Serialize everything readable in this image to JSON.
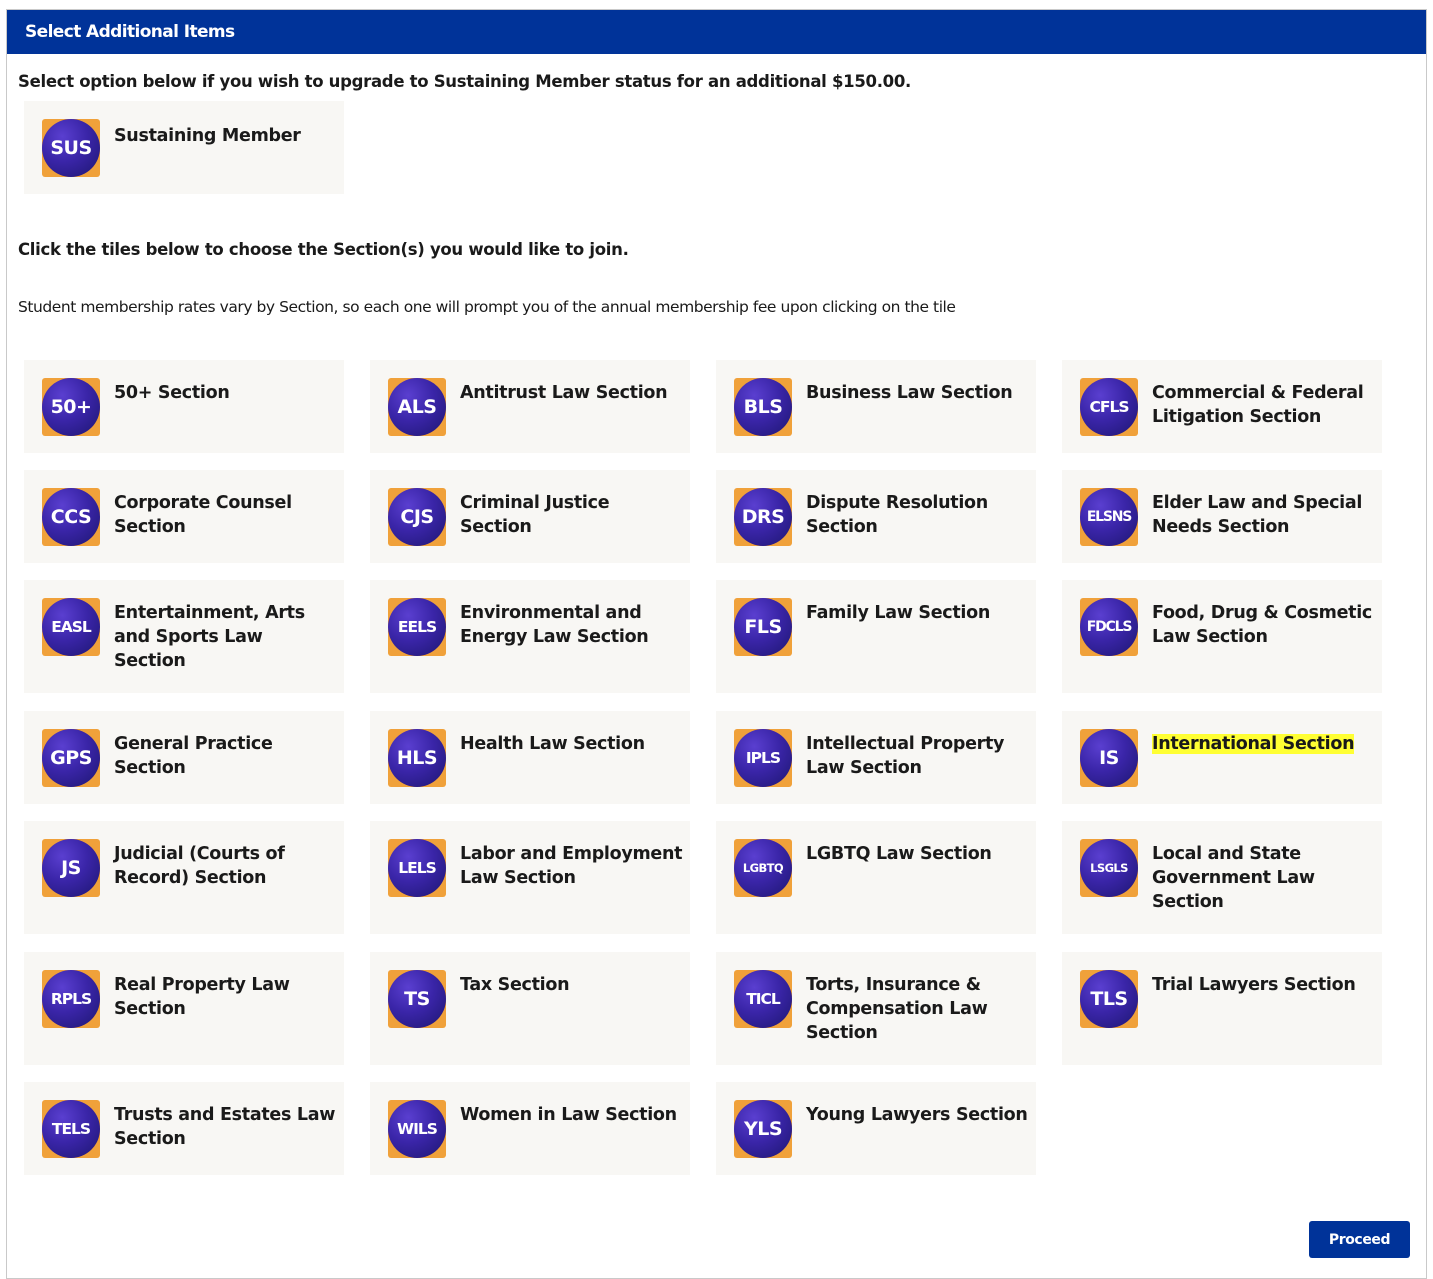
{
  "header": {
    "title": "Select Additional Items"
  },
  "upgrade": {
    "prompt": "Select option below if you wish to upgrade to Sustaining Member status for an additional $150.00.",
    "tile": {
      "badge": "SUS",
      "label": "Sustaining Member"
    }
  },
  "sections": {
    "prompt": "Click the tiles below to choose the Section(s) you would like to join.",
    "note": "Student membership rates vary by Section, so each one will prompt you of the annual membership fee upon clicking on the tile",
    "tiles": [
      {
        "badge": "50+",
        "label": "50+ Section"
      },
      {
        "badge": "ALS",
        "label": "Antitrust Law Section"
      },
      {
        "badge": "BLS",
        "label": "Business Law Section"
      },
      {
        "badge": "CFLS",
        "label": "Commercial & Federal Litigation Section"
      },
      {
        "badge": "CCS",
        "label": "Corporate Counsel Section"
      },
      {
        "badge": "CJS",
        "label": "Criminal Justice Section"
      },
      {
        "badge": "DRS",
        "label": "Dispute Resolution Section"
      },
      {
        "badge": "ELSNS",
        "label": "Elder Law and Special Needs Section"
      },
      {
        "badge": "EASL",
        "label": "Entertainment, Arts and Sports Law Section"
      },
      {
        "badge": "EELS",
        "label": "Environmental and Energy Law Section"
      },
      {
        "badge": "FLS",
        "label": "Family Law Section"
      },
      {
        "badge": "FDCLS",
        "label": "Food, Drug & Cosmetic Law Section"
      },
      {
        "badge": "GPS",
        "label": "General Practice Section"
      },
      {
        "badge": "HLS",
        "label": "Health Law Section"
      },
      {
        "badge": "IPLS",
        "label": "Intellectual Property Law Section"
      },
      {
        "badge": "IS",
        "label": "International Section",
        "highlighted": true
      },
      {
        "badge": "JS",
        "label": "Judicial (Courts of Record) Section"
      },
      {
        "badge": "LELS",
        "label": "Labor and Employment Law Section"
      },
      {
        "badge": "LGBTQ",
        "label": "LGBTQ Law Section"
      },
      {
        "badge": "LSGLS",
        "label": "Local and State Government Law Section"
      },
      {
        "badge": "RPLS",
        "label": "Real Property Law Section"
      },
      {
        "badge": "TS",
        "label": "Tax Section"
      },
      {
        "badge": "TICL",
        "label": "Torts, Insurance & Compensation Law Section"
      },
      {
        "badge": "TLS",
        "label": "Trial Lawyers Section"
      },
      {
        "badge": "TELS",
        "label": "Trusts and Estates Law Section"
      },
      {
        "badge": "WILS",
        "label": "Women in Law Section"
      },
      {
        "badge": "YLS",
        "label": "Young Lawyers Section"
      }
    ]
  },
  "actions": {
    "proceed_label": "Proceed"
  },
  "colors": {
    "header_bg": "#003399",
    "tile_bg": "#f8f7f4",
    "badge_square": "#f0a13a",
    "badge_circle": "#3a25a8",
    "highlight": "#ffff33"
  }
}
